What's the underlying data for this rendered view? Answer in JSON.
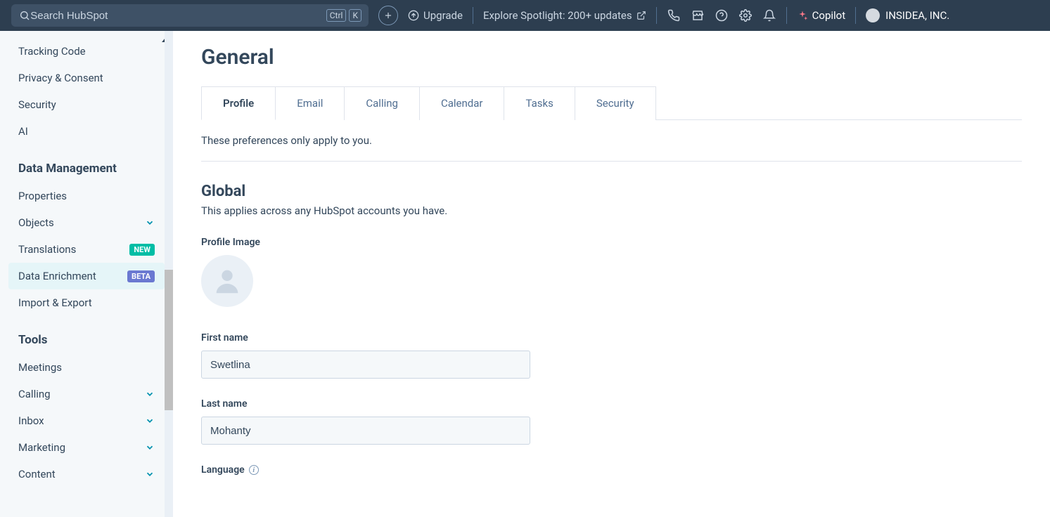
{
  "topnav": {
    "search_placeholder": "Search HubSpot",
    "kbd1": "Ctrl",
    "kbd2": "K",
    "upgrade": "Upgrade",
    "spotlight": "Explore Spotlight: 200+ updates",
    "copilot": "Copilot",
    "account": "INSIDEA, INC."
  },
  "sidebar": {
    "items_before": [
      "Tracking Code",
      "Privacy & Consent",
      "Security",
      "AI"
    ],
    "heading_data": "Data Management",
    "dm_properties": "Properties",
    "dm_objects": "Objects",
    "dm_translations": "Translations",
    "dm_translations_badge": "NEW",
    "dm_enrichment": "Data Enrichment",
    "dm_enrichment_badge": "BETA",
    "dm_import": "Import & Export",
    "heading_tools": "Tools",
    "tl_meetings": "Meetings",
    "tl_calling": "Calling",
    "tl_inbox": "Inbox",
    "tl_marketing": "Marketing",
    "tl_content": "Content"
  },
  "main": {
    "title": "General",
    "tabs": [
      "Profile",
      "Email",
      "Calling",
      "Calendar",
      "Tasks",
      "Security"
    ],
    "hint": "These preferences only apply to you.",
    "section_h2": "Global",
    "section_sub": "This applies across any HubSpot accounts you have.",
    "label_profile_image": "Profile Image",
    "label_first_name": "First name",
    "first_name_value": "Swetlina",
    "label_last_name": "Last name",
    "last_name_value": "Mohanty",
    "label_language": "Language"
  }
}
